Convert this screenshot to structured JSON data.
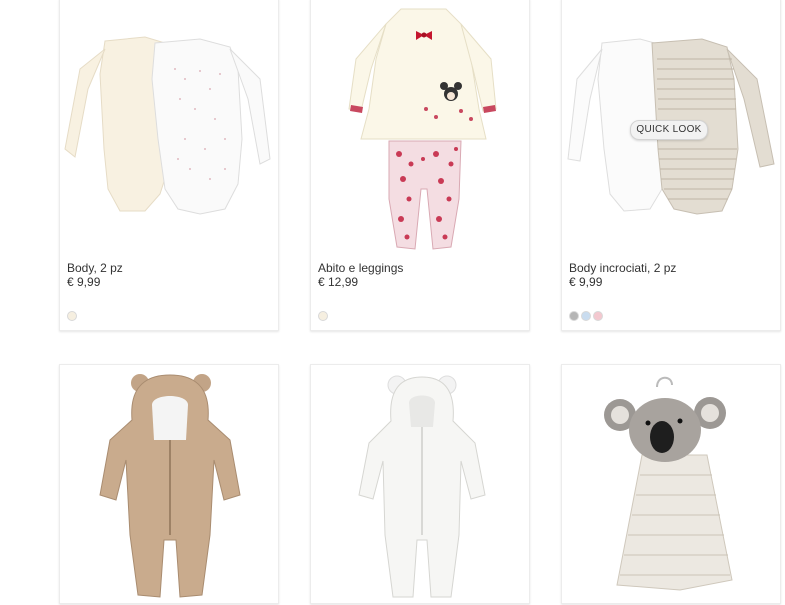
{
  "products": [
    {
      "name": "Body, 2 pz",
      "price": "€ 9,99",
      "swatches": [
        "#f6efe0"
      ]
    },
    {
      "name": "Abito e leggings",
      "price": "€ 12,99",
      "swatches": [
        "#f6efe0"
      ]
    },
    {
      "name": "Body incrociati, 2 pz",
      "price": "€ 9,99",
      "swatches": [
        "#b5b5b5",
        "#c9dcef",
        "#f3c8cf"
      ],
      "quick_look": "QUICK LOOK"
    },
    {
      "name": "",
      "price": ""
    },
    {
      "name": "",
      "price": ""
    },
    {
      "name": "",
      "price": ""
    }
  ]
}
